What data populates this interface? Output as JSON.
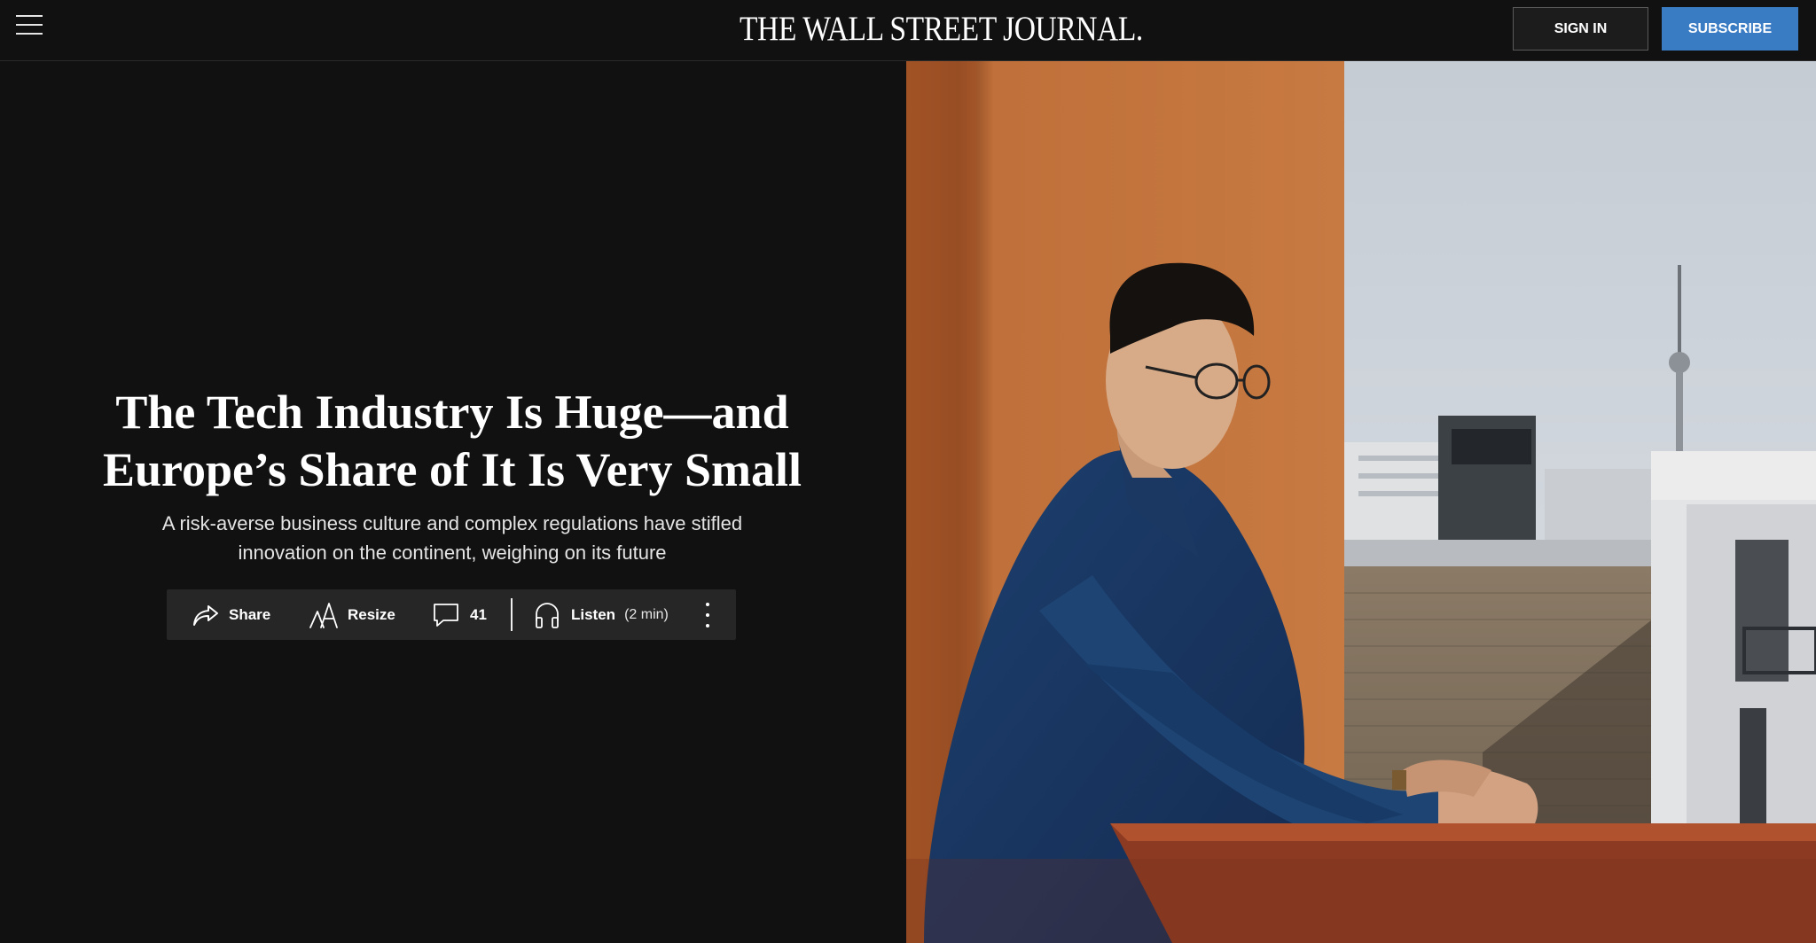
{
  "header": {
    "logo": "THE WALL STREET JOURNAL.",
    "sign_in": "SIGN IN",
    "subscribe": "SUBSCRIBE"
  },
  "article": {
    "headline_line1": "The Tech Industry Is Huge—and",
    "headline_line2": "Europe’s Share of It Is Very Small",
    "dek": "A risk-averse business culture and complex regulations have stifled innovation on the continent, weighing on its future"
  },
  "toolbar": {
    "share": "Share",
    "resize": "Resize",
    "comments_count": "41",
    "listen": "Listen",
    "listen_duration": "(2 min)"
  },
  "colors": {
    "background": "#111111",
    "subscribe_blue": "#3a7cc4",
    "toolbar_bg": "#262626"
  },
  "icons": [
    "menu-icon",
    "share-icon",
    "resize-icon",
    "comment-icon",
    "headphones-icon",
    "more-vertical-icon"
  ]
}
